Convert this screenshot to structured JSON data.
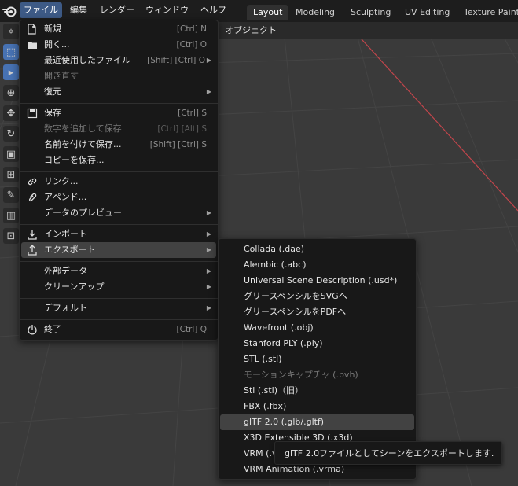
{
  "menubar": {
    "items": [
      {
        "label": "ファイル"
      },
      {
        "label": "編集"
      },
      {
        "label": "レンダー"
      },
      {
        "label": "ウィンドウ"
      },
      {
        "label": "ヘルプ"
      }
    ]
  },
  "workspaces": {
    "tabs": [
      {
        "label": "Layout"
      },
      {
        "label": "Modeling"
      },
      {
        "label": "Sculpting"
      },
      {
        "label": "UV Editing"
      },
      {
        "label": "Texture Paint"
      }
    ]
  },
  "viewport": {
    "header_label": "オブジェクト"
  },
  "file_menu": {
    "items": [
      {
        "label": "新規",
        "shortcut": "[Ctrl] N",
        "icon": "new-file-icon"
      },
      {
        "label": "開く...",
        "shortcut": "[Ctrl] O",
        "icon": "folder-icon"
      },
      {
        "label": "最近使用したファイル",
        "shortcut": "[Shift] [Ctrl] O"
      },
      {
        "label": "開き直す"
      },
      {
        "label": "復元"
      },
      {
        "label": "保存",
        "shortcut": "[Ctrl] S",
        "icon": "save-icon"
      },
      {
        "label": "数字を追加して保存",
        "shortcut": "[Ctrl] [Alt] S"
      },
      {
        "label": "名前を付けて保存...",
        "shortcut": "[Shift] [Ctrl] S"
      },
      {
        "label": "コピーを保存..."
      },
      {
        "label": "リンク...",
        "icon": "link-icon"
      },
      {
        "label": "アペンド...",
        "icon": "append-icon"
      },
      {
        "label": "データのプレビュー"
      },
      {
        "label": "インポート",
        "icon": "import-icon"
      },
      {
        "label": "エクスポート",
        "icon": "export-icon"
      },
      {
        "label": "外部データ"
      },
      {
        "label": "クリーンアップ"
      },
      {
        "label": "デフォルト"
      },
      {
        "label": "終了",
        "shortcut": "[Ctrl] Q",
        "icon": "power-icon"
      }
    ]
  },
  "export_menu": {
    "items": [
      {
        "label": "Collada (.dae)"
      },
      {
        "label": "Alembic (.abc)"
      },
      {
        "label": "Universal Scene Description (.usd*)"
      },
      {
        "label": "グリースペンシルをSVGへ"
      },
      {
        "label": "グリースペンシルをPDFへ"
      },
      {
        "label": "Wavefront (.obj)"
      },
      {
        "label": "Stanford PLY (.ply)"
      },
      {
        "label": "STL (.stl)"
      },
      {
        "label": "モーションキャプチャ (.bvh)"
      },
      {
        "label": "Stl (.stl)（旧）"
      },
      {
        "label": "FBX (.fbx)"
      },
      {
        "label": "glTF 2.0 (.glb/.gltf)"
      },
      {
        "label": "X3D Extensible 3D (.x3d)"
      },
      {
        "label": "VRM (.vrm)"
      },
      {
        "label": "VRM Animation (.vrma)"
      }
    ]
  },
  "tooltip": {
    "text": "glTF 2.0ファイルとしてシーンをエクスポートします."
  },
  "colors": {
    "accent": "#4772b3",
    "menu_bg": "#181818",
    "highlight": "#424242",
    "axis_x": "#c2454b"
  }
}
